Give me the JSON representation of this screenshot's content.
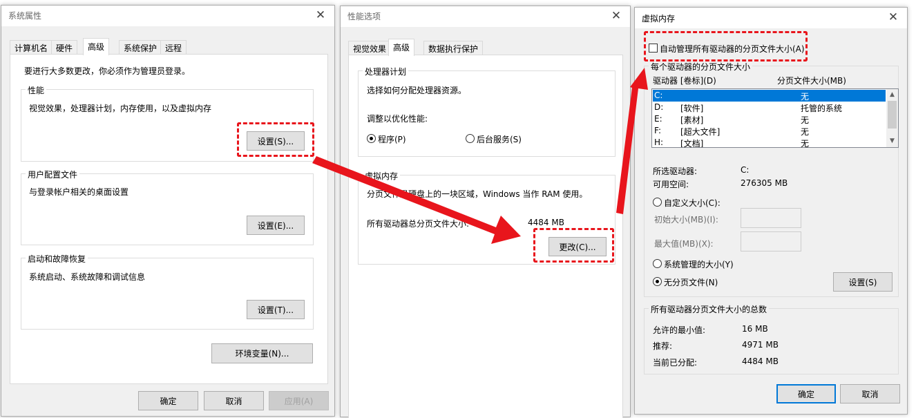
{
  "sys_props": {
    "title": "系统属性",
    "tabs": [
      "计算机名",
      "硬件",
      "高级",
      "系统保护",
      "远程"
    ],
    "active_tab": "高级",
    "admin_note": "要进行大多数更改，你必须作为管理员登录。",
    "performance": {
      "title": "性能",
      "description": "视觉效果，处理器计划，内存使用，以及虚拟内存",
      "settings_label": "设置(S)..."
    },
    "user_profiles": {
      "title": "用户配置文件",
      "description": "与登录帐户相关的桌面设置",
      "settings_label": "设置(E)..."
    },
    "startup": {
      "title": "启动和故障恢复",
      "description": "系统启动、系统故障和调试信息",
      "settings_label": "设置(T)..."
    },
    "env_vars_label": "环境变量(N)...",
    "ok_label": "确定",
    "cancel_label": "取消",
    "apply_label": "应用(A)"
  },
  "perf_opts": {
    "title": "性能选项",
    "tabs": [
      "视觉效果",
      "高级",
      "数据执行保护"
    ],
    "active_tab": "高级",
    "scheduling": {
      "title": "处理器计划",
      "description": "选择如何分配处理器资源。",
      "adjust_label": "调整以优化性能:",
      "programs_label": "程序(P)",
      "background_label": "后台服务(S)"
    },
    "virtual_memory": {
      "title": "虚拟内存",
      "description": "分页文件是硬盘上的一块区域，Windows 当作 RAM 使用。",
      "total_label": "所有驱动器总分页文件大小:",
      "total_value": "4484 MB",
      "change_label": "更改(C)..."
    }
  },
  "vm": {
    "title": "虚拟内存",
    "auto_manage_label": "自动管理所有驱动器的分页文件大小(A)",
    "auto_manage_checked": false,
    "per_drive_title": "每个驱动器的分页文件大小",
    "col_drive": "驱动器 [卷标](D)",
    "col_size": "分页文件大小(MB)",
    "drives": [
      {
        "drive": "C:",
        "label": "",
        "size": "无"
      },
      {
        "drive": "D:",
        "label": "[软件]",
        "size": "托管的系统"
      },
      {
        "drive": "E:",
        "label": "[素材]",
        "size": "无"
      },
      {
        "drive": "F:",
        "label": "[超大文件]",
        "size": "无"
      },
      {
        "drive": "H:",
        "label": "[文档]",
        "size": "无"
      }
    ],
    "selected_drive_label": "所选驱动器:",
    "selected_drive_value": "C:",
    "free_space_label": "可用空间:",
    "free_space_value": "276305 MB",
    "custom_size_label": "自定义大小(C):",
    "initial_size_label": "初始大小(MB)(I):",
    "max_size_label": "最大值(MB)(X):",
    "system_managed_label": "系统管理的大小(Y)",
    "no_paging_label": "无分页文件(N)",
    "set_label": "设置(S)",
    "totals_title": "所有驱动器分页文件大小的总数",
    "min_allowed_label": "允许的最小值:",
    "min_allowed_value": "16 MB",
    "recommended_label": "推荐:",
    "recommended_value": "4971 MB",
    "allocated_label": "当前已分配:",
    "allocated_value": "4484 MB",
    "ok_label": "确定",
    "cancel_label": "取消"
  },
  "colors": {
    "highlight": "#e8151c",
    "selection": "#0078d7",
    "dialog_bg": "#f0f0f0"
  },
  "icons": {
    "close": "close-icon",
    "arrow": "red-arrow"
  }
}
